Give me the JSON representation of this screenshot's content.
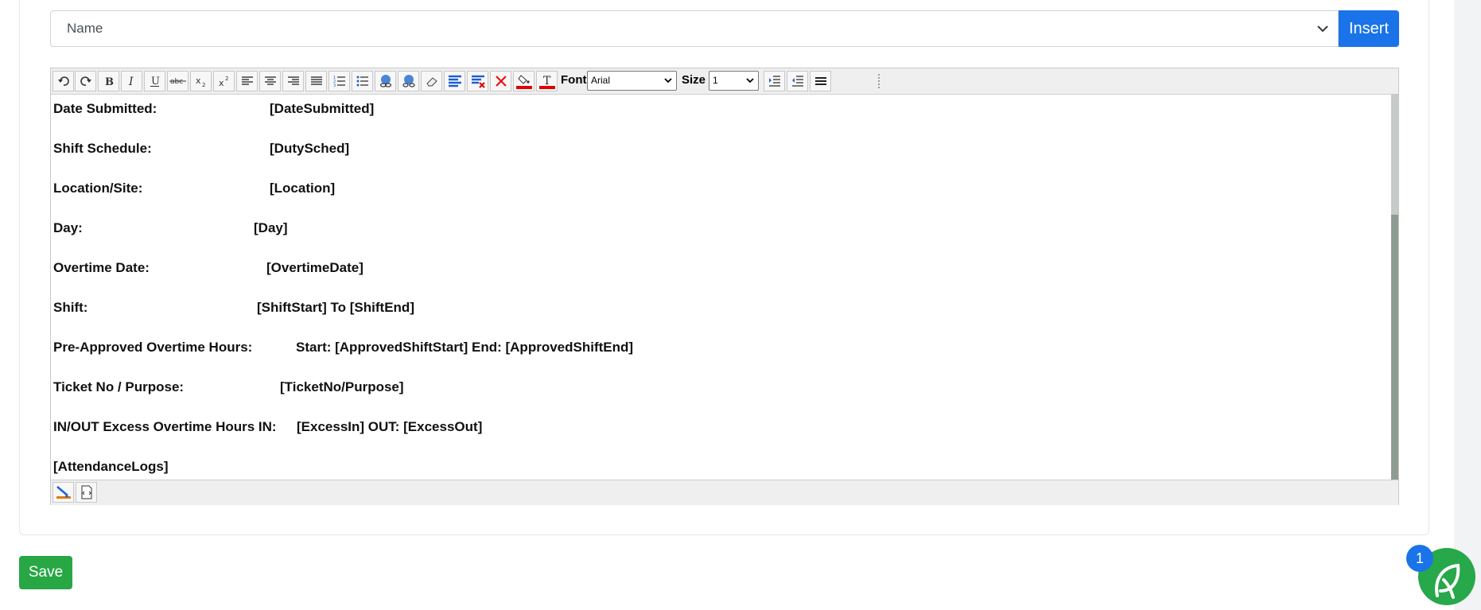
{
  "field_select": {
    "selected": "Name",
    "insert_label": "Insert"
  },
  "toolbar": {
    "font_label": "Font",
    "font_value": "Arial",
    "size_label": "Size",
    "size_value": "1",
    "buttons": [
      "undo-icon",
      "redo-icon",
      "bold-icon",
      "italic-icon",
      "underline-icon",
      "strikethrough-icon",
      "subscript-icon",
      "superscript-icon",
      "align-left-icon",
      "align-center-icon",
      "align-right-icon",
      "align-justify-icon",
      "ordered-list-icon",
      "unordered-list-icon",
      "link-icon",
      "unlink-icon",
      "eraser-icon",
      "paragraph-style-icon",
      "remove-format-icon",
      "delete-icon",
      "highlight-color-icon",
      "text-color-icon",
      "indent-icon",
      "outdent-icon",
      "horizontal-rule-icon"
    ]
  },
  "editor_lines": [
    {
      "label": "Date Submitted:",
      "value": "[DateSubmitted]"
    },
    {
      "label": "Shift Schedule:",
      "value": "[DutySched]"
    },
    {
      "label": "Location/Site:",
      "value": "[Location]"
    },
    {
      "label": "Day:",
      "value": "[Day]"
    },
    {
      "label": "Overtime Date:",
      "value": "[OvertimeDate]"
    },
    {
      "label": "Shift:",
      "value": "[ShiftStart] To [ShiftEnd]"
    },
    {
      "label": "Pre-Approved Overtime Hours:",
      "value": "Start: [ApprovedShiftStart] End:  [ApprovedShiftEnd]"
    },
    {
      "label": "Ticket No / Purpose:",
      "value": "[TicketNo/Purpose]"
    },
    {
      "label": "IN/OUT Excess Overtime Hours IN:",
      "value": "[ExcessIn] OUT: [ExcessOut]"
    },
    {
      "label": "[AttendanceLogs]",
      "value": ""
    }
  ],
  "bottom_bar": {
    "buttons": [
      "design-mode-icon",
      "html-source-icon"
    ]
  },
  "save_label": "Save",
  "chat": {
    "badge_count": "1"
  },
  "colors": {
    "primary": "#1a73e8",
    "success": "#28a745",
    "chat": "#27a84a",
    "text_color_bar": "#e00000"
  }
}
